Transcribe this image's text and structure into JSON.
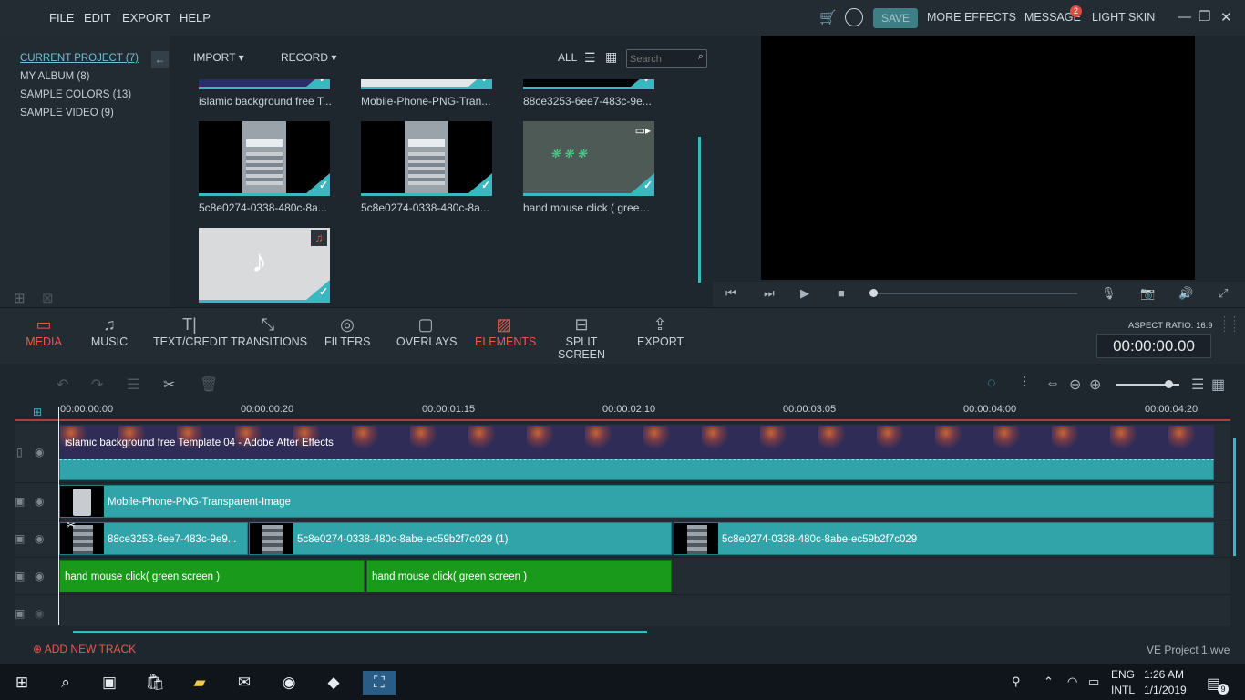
{
  "menu": {
    "file": "FILE",
    "edit": "EDIT",
    "export": "EXPORT",
    "help": "HELP"
  },
  "header": {
    "save": "SAVE",
    "more_effects": "MORE EFFECTS",
    "message": "MESSAGE",
    "message_count": "2",
    "light_skin": "LIGHT SKIN"
  },
  "sidebar": {
    "items": [
      {
        "label": "CURRENT PROJECT (7)"
      },
      {
        "label": "MY ALBUM (8)"
      },
      {
        "label": "SAMPLE COLORS (13)"
      },
      {
        "label": "SAMPLE VIDEO (9)"
      }
    ]
  },
  "media": {
    "import": "IMPORT",
    "record": "RECORD",
    "filter_all": "ALL",
    "search_placeholder": "Search",
    "items": [
      {
        "label": "islamic background free T..."
      },
      {
        "label": "Mobile-Phone-PNG-Tran..."
      },
      {
        "label": "88ce3253-6ee7-483c-9e..."
      },
      {
        "label": "5c8e0274-0338-480c-8a..."
      },
      {
        "label": "5c8e0274-0338-480c-8a..."
      },
      {
        "label": "hand mouse click ( green s..."
      }
    ]
  },
  "tools": {
    "items": [
      {
        "label": "MEDIA",
        "icon": "folder-icon"
      },
      {
        "label": "MUSIC",
        "icon": "music-note-icon"
      },
      {
        "label": "TEXT/CREDIT",
        "icon": "text-icon"
      },
      {
        "label": "TRANSITIONS",
        "icon": "transitions-icon"
      },
      {
        "label": "FILTERS",
        "icon": "filters-icon"
      },
      {
        "label": "OVERLAYS",
        "icon": "overlays-icon"
      },
      {
        "label": "ELEMENTS",
        "icon": "elements-icon"
      },
      {
        "label": "SPLIT SCREEN",
        "icon": "split-screen-icon"
      },
      {
        "label": "EXPORT",
        "icon": "export-icon"
      }
    ]
  },
  "preview": {
    "aspect_ratio": "ASPECT RATIO: 16:9",
    "timecode": "00:00:00.00"
  },
  "ruler": {
    "ticks": [
      "00:00:00:00",
      "00:00:00:20",
      "00:00:01:15",
      "00:00:02:10",
      "00:00:03:05",
      "00:00:04:00",
      "00:00:04:20"
    ]
  },
  "timeline": {
    "clip_bg": "islamic background free Template 04  - Adobe After Effects",
    "clip_phone": "Mobile-Phone-PNG-Transparent-Image",
    "clip_s1": "88ce3253-6ee7-483c-9e9...",
    "clip_s2": "5c8e0274-0338-480c-8abe-ec59b2f7c029 (1)",
    "clip_s3": "5c8e0274-0338-480c-8abe-ec59b2f7c029",
    "clip_g1": "hand mouse click( green screen )",
    "clip_g2": "hand mouse click( green screen )"
  },
  "footer": {
    "add_track": "ADD NEW TRACK",
    "project_name": "VE Project 1.wve"
  },
  "taskbar": {
    "lang1": "ENG",
    "lang2": "INTL",
    "time": "1:26 AM",
    "date": "1/1/2019",
    "notif_count": "9"
  },
  "colors": {
    "accent": "#39b8bf",
    "active": "#e35b4f",
    "clip": "#31a4a9",
    "green": "#1a9a1a"
  }
}
